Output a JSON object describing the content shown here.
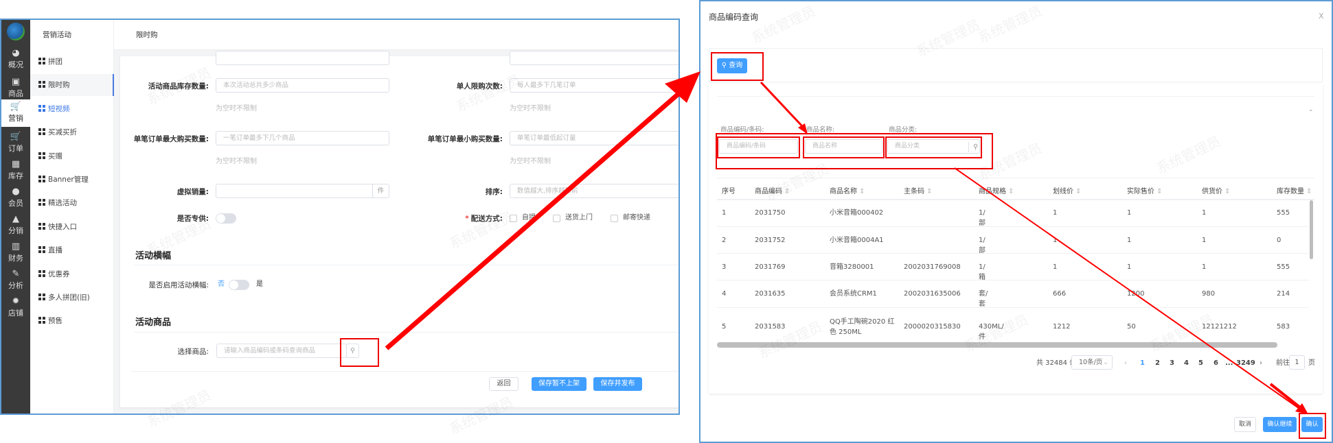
{
  "watermark": "系统管理员",
  "sidebar": {
    "items": [
      {
        "label": "概况",
        "icon": "dashboard-icon"
      },
      {
        "label": "商品",
        "icon": "goods-icon"
      },
      {
        "label": "营销",
        "icon": "cart-icon"
      },
      {
        "label": "订单",
        "icon": "order-icon"
      },
      {
        "label": "库存",
        "icon": "stock-icon"
      },
      {
        "label": "会员",
        "icon": "member-icon"
      },
      {
        "label": "分销",
        "icon": "distribution-icon"
      },
      {
        "label": "财务",
        "icon": "finance-icon"
      },
      {
        "label": "分析",
        "icon": "analysis-icon"
      },
      {
        "label": "店铺",
        "icon": "store-icon"
      }
    ]
  },
  "submenu": {
    "title": "营销活动",
    "items": [
      "拼团",
      "限时购",
      "短视频",
      "买减买折",
      "买赠",
      "Banner管理",
      "精选活动",
      "快捷入口",
      "直播",
      "优惠券",
      "多人拼团(旧)",
      "预售"
    ]
  },
  "page": {
    "title": "限时购"
  },
  "form": {
    "stock_label": "活动商品库存数量:",
    "stock_placeholder": "本次活动总共多少商品",
    "stock_hint": "为空时不限制",
    "limit_label": "单人限购次数:",
    "limit_placeholder": "每人最多下几笔订单",
    "limit_hint": "为空时不限制",
    "max_label": "单笔订单最大购买数量:",
    "max_placeholder": "一笔订单最多下几个商品",
    "max_hint": "为空时不限制",
    "min_label": "单笔订单最小购买数量:",
    "min_placeholder": "单笔订单最低起订量",
    "min_hint": "为空时不限制",
    "virtual_label": "虚拟销量:",
    "virtual_unit": "件",
    "sort_label": "排序:",
    "sort_placeholder": "数值越大,排序越靠前",
    "exclusive_label": "是否专供:",
    "delivery_label": "配送方式:",
    "delivery_required": "*",
    "delivery_options": [
      "自提",
      "送货上门",
      "邮寄快递"
    ],
    "banner_section": "活动横幅",
    "banner_label": "是否启用活动横幅:",
    "banner_off": "否",
    "banner_on": "是",
    "goods_section": "活动商品",
    "goods_label": "选择商品:",
    "goods_placeholder": "请输入商品编码或条码查询商品",
    "back": "返回",
    "save_draft": "保存暂不上架",
    "save_publish": "保存并发布"
  },
  "dialog": {
    "title": "商品编码查询",
    "close": "X",
    "query": "查询",
    "filters": [
      {
        "label": "商品编码/条码:",
        "placeholder": "商品编码/条码"
      },
      {
        "label": "商品名称:",
        "placeholder": "商品名称"
      },
      {
        "label": "商品分类:",
        "placeholder": "商品分类"
      }
    ],
    "columns": [
      "序号",
      "商品编码",
      "商品名称",
      "主条码",
      "商品规格",
      "划线价",
      "实际售价",
      "供货价",
      "库存数量"
    ],
    "rows": [
      [
        "1",
        "2031750",
        "小米音箱000402",
        "",
        "1/部",
        "1",
        "1",
        "1",
        "555"
      ],
      [
        "2",
        "2031752",
        "小米音箱0004A1",
        "",
        "1/部",
        "1",
        "1",
        "1",
        "0"
      ],
      [
        "3",
        "2031769",
        "音箱3280001",
        "2002031769008",
        "1/箱",
        "1",
        "1",
        "1",
        "555"
      ],
      [
        "4",
        "2031635",
        "会员系统CRM1",
        "2002031635006",
        "套/套",
        "666",
        "1200",
        "980",
        "214"
      ],
      [
        "5",
        "2031583",
        "QQ手工陶碗2020 红色 250ML",
        "2000020315830",
        "430ML/件",
        "1212",
        "50",
        "12121212",
        "583"
      ]
    ],
    "pagination": {
      "total": "共 32484 条",
      "page_size": "10条/页",
      "pages": [
        "1",
        "2",
        "3",
        "4",
        "5",
        "6",
        "...",
        "3249"
      ],
      "current": "1",
      "goto_label": "前往",
      "goto_value": "1",
      "page_unit": "页"
    },
    "cancel": "取消",
    "confirm_continue": "确认继续",
    "confirm": "确认"
  },
  "colors": {
    "primary": "#409eff",
    "annotation": "#ee0000",
    "sidebar": "#3a3a3a"
  }
}
